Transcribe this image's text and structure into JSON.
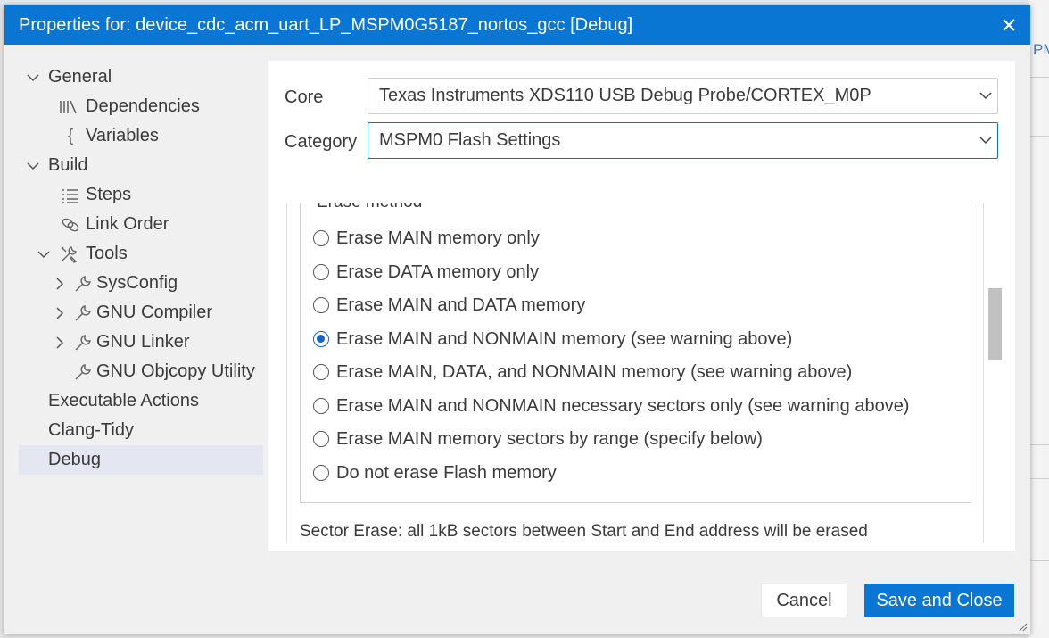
{
  "window": {
    "title": "Properties for: device_cdc_acm_uart_LP_MSPM0G5187_nortos_gcc [Debug]",
    "background_label": "PM"
  },
  "tree": {
    "items": [
      {
        "label": "General",
        "icon": "chevron-down-icon"
      },
      {
        "label": "Dependencies",
        "icon": "library-icon"
      },
      {
        "label": "Variables",
        "icon": "braces-icon"
      },
      {
        "label": "Build",
        "icon": "chevron-down-icon"
      },
      {
        "label": "Steps",
        "icon": "list-icon"
      },
      {
        "label": "Link Order",
        "icon": "link-icon"
      },
      {
        "label": "Tools",
        "icon": "tools-icon"
      },
      {
        "label": "SysConfig",
        "icon": "wrench-icon"
      },
      {
        "label": "GNU Compiler",
        "icon": "wrench-icon"
      },
      {
        "label": "GNU Linker",
        "icon": "wrench-icon"
      },
      {
        "label": "GNU Objcopy Utility",
        "icon": "wrench-icon"
      },
      {
        "label": "Executable Actions"
      },
      {
        "label": "Clang-Tidy"
      },
      {
        "label": "Debug",
        "selected": true
      }
    ]
  },
  "form": {
    "core_label": "Core",
    "core_value": "Texas Instruments XDS110 USB Debug Probe/CORTEX_M0P",
    "category_label": "Category",
    "category_value": "MSPM0 Flash Settings"
  },
  "erase": {
    "legend": "Erase method",
    "options": [
      {
        "label": "Erase MAIN memory only",
        "checked": false
      },
      {
        "label": "Erase DATA memory only",
        "checked": false
      },
      {
        "label": "Erase MAIN and DATA memory",
        "checked": false
      },
      {
        "label": "Erase MAIN and NONMAIN memory (see warning above)",
        "checked": true
      },
      {
        "label": "Erase MAIN, DATA, and NONMAIN memory (see warning above)",
        "checked": false
      },
      {
        "label": "Erase MAIN and NONMAIN necessary sectors only (see warning above)",
        "checked": false
      },
      {
        "label": "Erase MAIN memory sectors by range (specify below)",
        "checked": false
      },
      {
        "label": "Do not erase Flash memory",
        "checked": false
      }
    ],
    "sector_note": "Sector Erase: all 1kB sectors between Start and End address will be erased"
  },
  "buttons": {
    "cancel": "Cancel",
    "save": "Save and Close"
  },
  "colors": {
    "accent": "#0a76d4",
    "selected_row": "#e4e6f1"
  }
}
